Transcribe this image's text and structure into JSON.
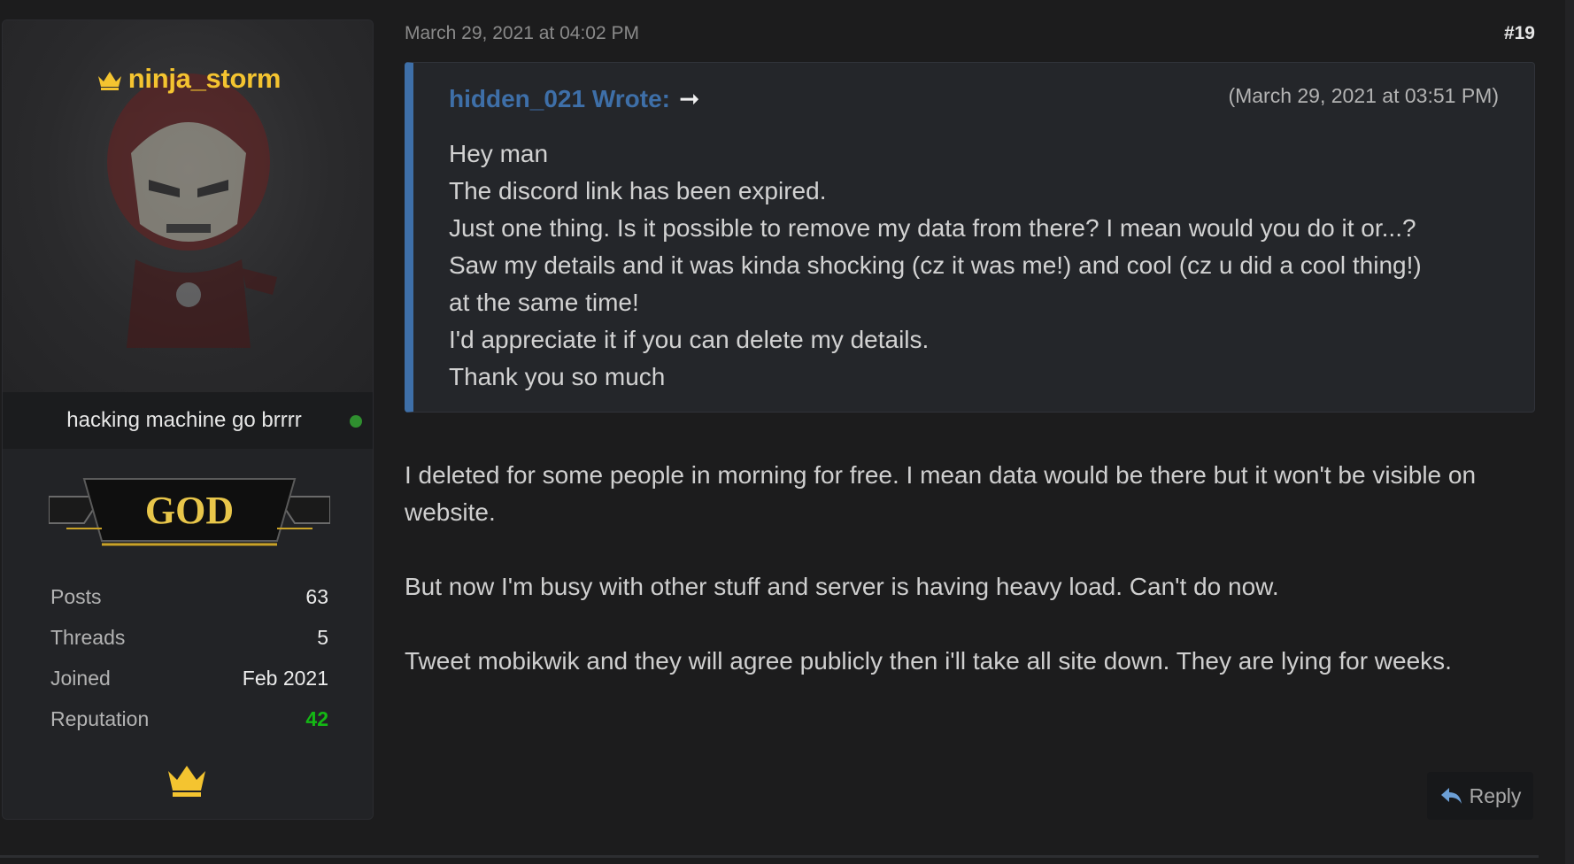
{
  "user": {
    "username": "ninja_storm",
    "usertitle": "hacking machine go brrrr",
    "rank_badge_text": "GOD",
    "online_status_color": "#2f8f2f",
    "username_color": "#f4c430",
    "stats": [
      {
        "label": "Posts",
        "value": "63"
      },
      {
        "label": "Threads",
        "value": "5"
      },
      {
        "label": "Joined",
        "value": "Feb 2021"
      },
      {
        "label": "Reputation",
        "value": "42"
      }
    ],
    "award_icon": "crown-icon"
  },
  "post": {
    "date": "March 29, 2021 at 04:02 PM",
    "number": "#19",
    "quote": {
      "author": "hidden_021 Wrote:",
      "arrow": "➞",
      "date": "(March 29, 2021 at 03:51 PM)",
      "lines": [
        "Hey man",
        "The discord link has been expired.",
        "Just one thing. Is it possible to remove my data from there? I mean would you do it or...?",
        "Saw my details and it was kinda shocking (cz it was me!) and cool (cz u did a cool thing!)",
        "at the same time!",
        "I'd appreciate it if you can delete my details.",
        "Thank you so much"
      ]
    },
    "messages": [
      "I deleted for some people in morning for free. I mean data would be there but it won't be visible on website.",
      "But now I'm busy with other stuff and server is having heavy load. Can't do now.",
      "Tweet mobikwik and they will agree publicly then i'll take all site down. They are lying for weeks."
    ],
    "reply_label": "Reply",
    "accent_color": "#3e6fa8"
  }
}
